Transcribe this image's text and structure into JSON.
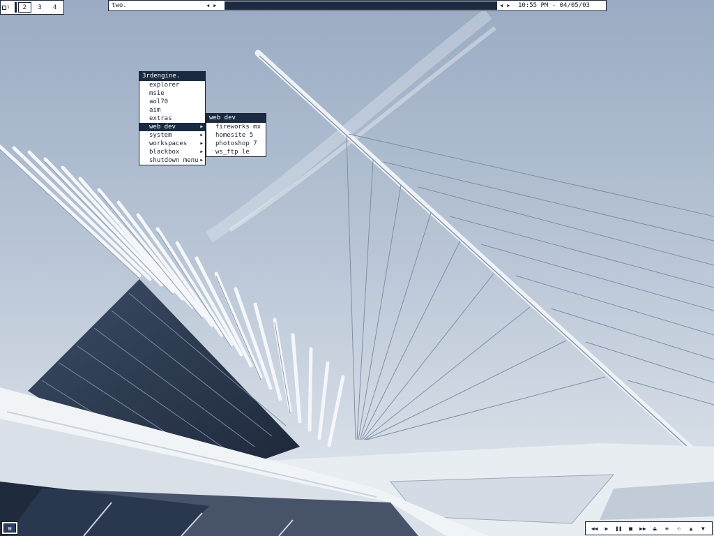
{
  "pager": {
    "workspaces": [
      "1",
      "2",
      "3",
      "4"
    ],
    "active": "2"
  },
  "toolbar": {
    "workspace_name": "two.",
    "clock": "10:55 PM - 04/05/03"
  },
  "root_menu": {
    "title": "3rdengine.",
    "items": [
      {
        "label": "explorer",
        "has_submenu": false
      },
      {
        "label": "msie",
        "has_submenu": false
      },
      {
        "label": "aol70",
        "has_submenu": false
      },
      {
        "label": "aim",
        "has_submenu": false
      },
      {
        "label": "extras",
        "has_submenu": false
      },
      {
        "label": "web dev",
        "has_submenu": true
      },
      {
        "label": "system",
        "has_submenu": true
      },
      {
        "label": "workspaces",
        "has_submenu": true
      },
      {
        "label": "blackbox",
        "has_submenu": true
      },
      {
        "label": "shutdown menu",
        "has_submenu": true
      }
    ],
    "selected": "web dev"
  },
  "submenu": {
    "title": "web dev",
    "items": [
      {
        "label": "fireworks mx"
      },
      {
        "label": "homesite 5"
      },
      {
        "label": "photoshop 7"
      },
      {
        "label": "ws_ftp le"
      }
    ]
  },
  "media_controls": [
    "previous-icon",
    "play-icon",
    "pause-icon",
    "stop-icon",
    "next-icon",
    "eject-icon",
    "playlist-icon",
    "options-icon",
    "volume-up-icon",
    "volume-down-icon"
  ],
  "colors": {
    "accent": "#1a2a40",
    "frame": "#1a2233",
    "panel": "#ffffff"
  }
}
